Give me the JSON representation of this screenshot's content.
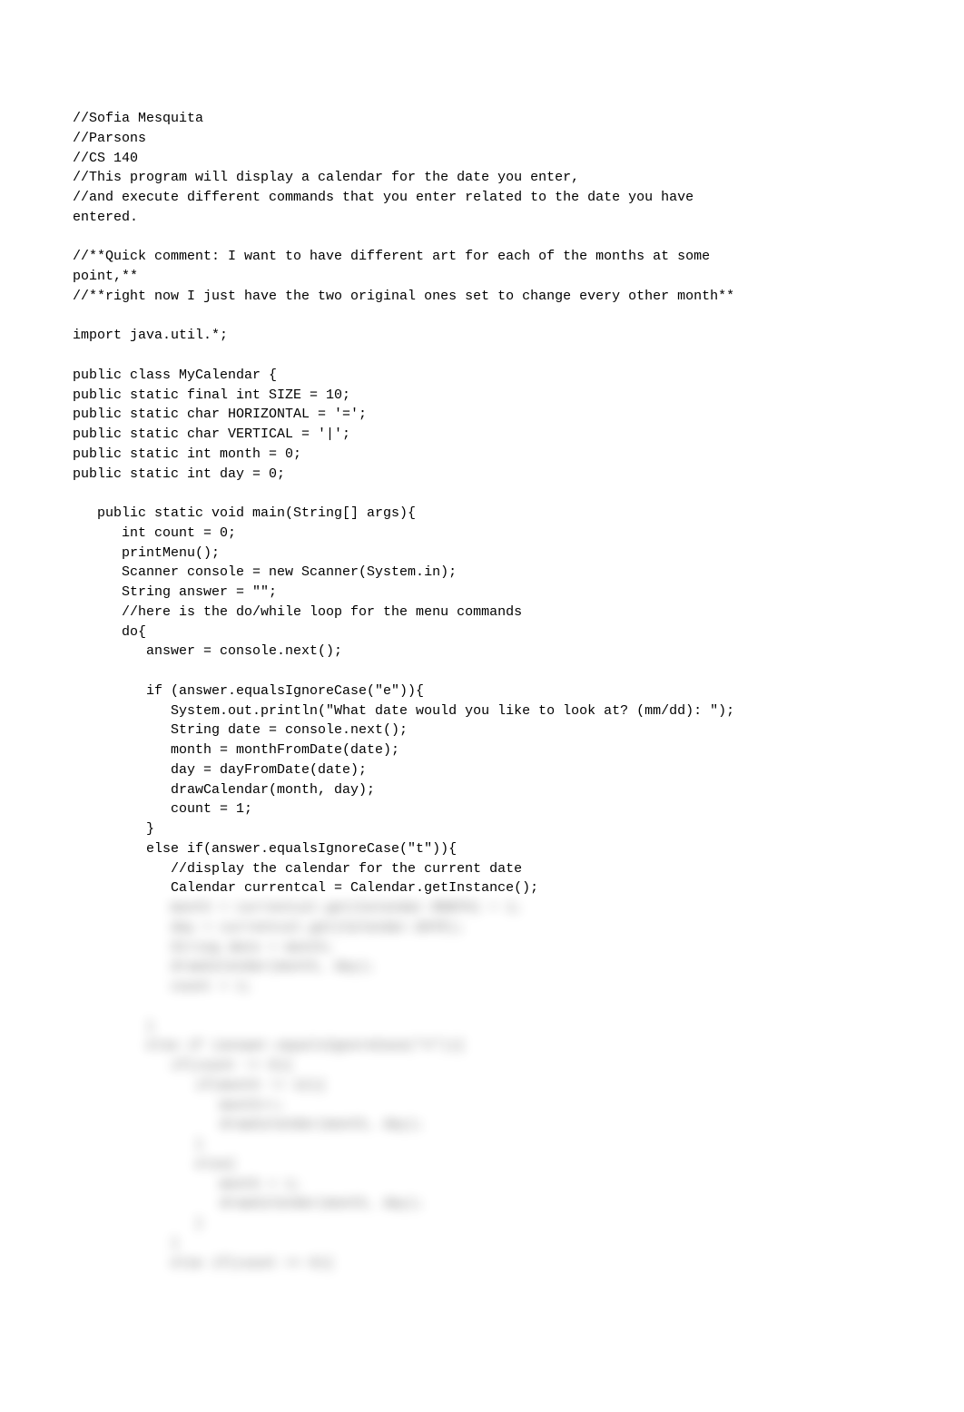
{
  "code": {
    "lines": [
      "//Sofia Mesquita",
      "//Parsons",
      "//CS 140",
      "//This program will display a calendar for the date you enter,",
      "//and execute different commands that you enter related to the date you have",
      "entered.",
      "",
      "//**Quick comment: I want to have different art for each of the months at some",
      "point,**",
      "//**right now I just have the two original ones set to change every other month**",
      "",
      "import java.util.*;",
      "",
      "public class MyCalendar {",
      "public static final int SIZE = 10;",
      "public static char HORIZONTAL = '=';",
      "public static char VERTICAL = '|';",
      "public static int month = 0;",
      "public static int day = 0;",
      "",
      "   public static void main(String[] args){",
      "      int count = 0;",
      "      printMenu();",
      "      Scanner console = new Scanner(System.in);",
      "      String answer = \"\";",
      "      //here is the do/while loop for the menu commands",
      "      do{",
      "         answer = console.next();",
      "",
      "         if (answer.equalsIgnoreCase(\"e\")){",
      "            System.out.println(\"What date would you like to look at? (mm/dd): \");",
      "            String date = console.next();",
      "            month = monthFromDate(date);",
      "            day = dayFromDate(date);",
      "            drawCalendar(month, day);",
      "            count = 1;",
      "         }",
      "         else if(answer.equalsIgnoreCase(\"t\")){",
      "            //display the calendar for the current date",
      "            Calendar currentcal = Calendar.getInstance();"
    ],
    "blurred_lines": [
      "            month = currentcal.get(Calendar.MONTH) + 1;",
      "            day = currentcal.get(Calendar.DATE);",
      "            String date = month;",
      "            drawCalendar(month, day);",
      "            count = 1;",
      "",
      "         }",
      "         else if (answer.equalsIgnoreCase(\"n\")){",
      "            if(count != 0){",
      "               if(month != 12){",
      "                  month++;",
      "                  drawCalendar(month, day);",
      "               }",
      "               else{",
      "                  month = 1;",
      "                  drawCalendar(month, day);",
      "               }",
      "            }",
      "            else if(count == 0){"
    ]
  }
}
